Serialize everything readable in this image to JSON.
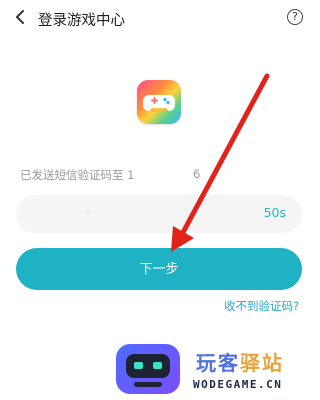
{
  "header": {
    "back_glyph": "<",
    "title": "登录游戏中心",
    "help_glyph": "?"
  },
  "app_icon": {
    "name": "gamepad-icon"
  },
  "sms": {
    "sent_label": "已发送短信验证码至 1",
    "sent_tail": "6"
  },
  "code_input": {
    "value": "-",
    "countdown": "50s"
  },
  "actions": {
    "next_label": "下一步",
    "no_code_link": "收不到验证码?"
  },
  "watermark": {
    "cn_part1": "玩客",
    "cn_part2": "驿站",
    "en": "WODEGAME.CN"
  },
  "colors": {
    "accent": "#1fb2c5",
    "link": "#29a7c8",
    "arrow": "#e2231a"
  }
}
